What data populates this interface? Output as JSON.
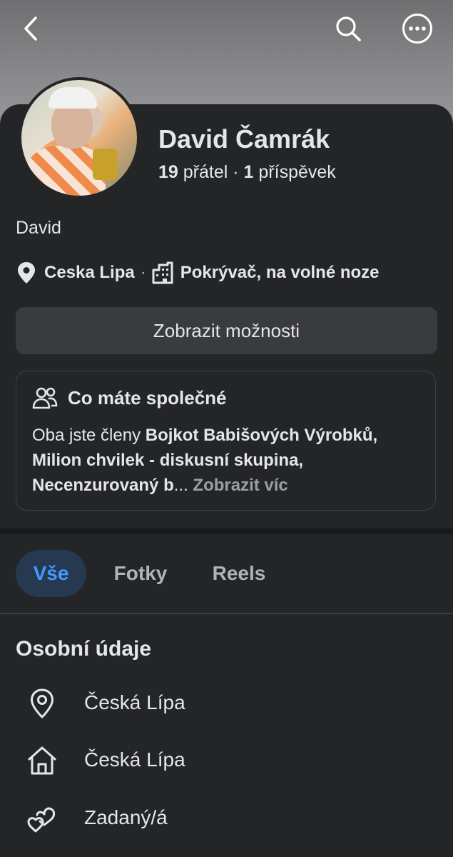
{
  "profile": {
    "name": "David Čamrák",
    "friends_count": "19",
    "friends_label": "přátel",
    "separator": "·",
    "posts_count": "1",
    "posts_label": "příspěvek",
    "bio": "David",
    "location": "Ceska Lipa",
    "work": "Pokrývač, na volné noze"
  },
  "icons": {
    "back": "chevron-left-icon",
    "search": "search-icon",
    "more": "more-options-icon",
    "location": "location-pin-icon",
    "work": "building-icon",
    "common": "people-icon",
    "current_city": "location-pin-outline-icon",
    "hometown": "home-icon",
    "relationship": "hearts-icon"
  },
  "actions": {
    "show_options": "Zobrazit možnosti"
  },
  "common": {
    "title": "Co máte společné",
    "intro": "Oba jste členy ",
    "groups": "Bojkot Babišových Výrobků, Milion chvilek - diskusní skupina, Necenzurovaný b",
    "ellipsis": "...",
    "more": "Zobrazit víc"
  },
  "tabs": [
    {
      "label": "Vše",
      "active": true
    },
    {
      "label": "Fotky",
      "active": false
    },
    {
      "label": "Reels",
      "active": false
    }
  ],
  "personal": {
    "title": "Osobní údaje",
    "items": [
      {
        "icon": "location-pin-outline-icon",
        "text": "Česká Lípa"
      },
      {
        "icon": "home-icon",
        "text": "Česká Lípa"
      },
      {
        "icon": "hearts-icon",
        "text": "Zadaný/á"
      }
    ]
  },
  "colors": {
    "background": "#242526",
    "button": "#3a3b3c",
    "accent": "#4599ff",
    "active_tab_bg": "#263951"
  }
}
